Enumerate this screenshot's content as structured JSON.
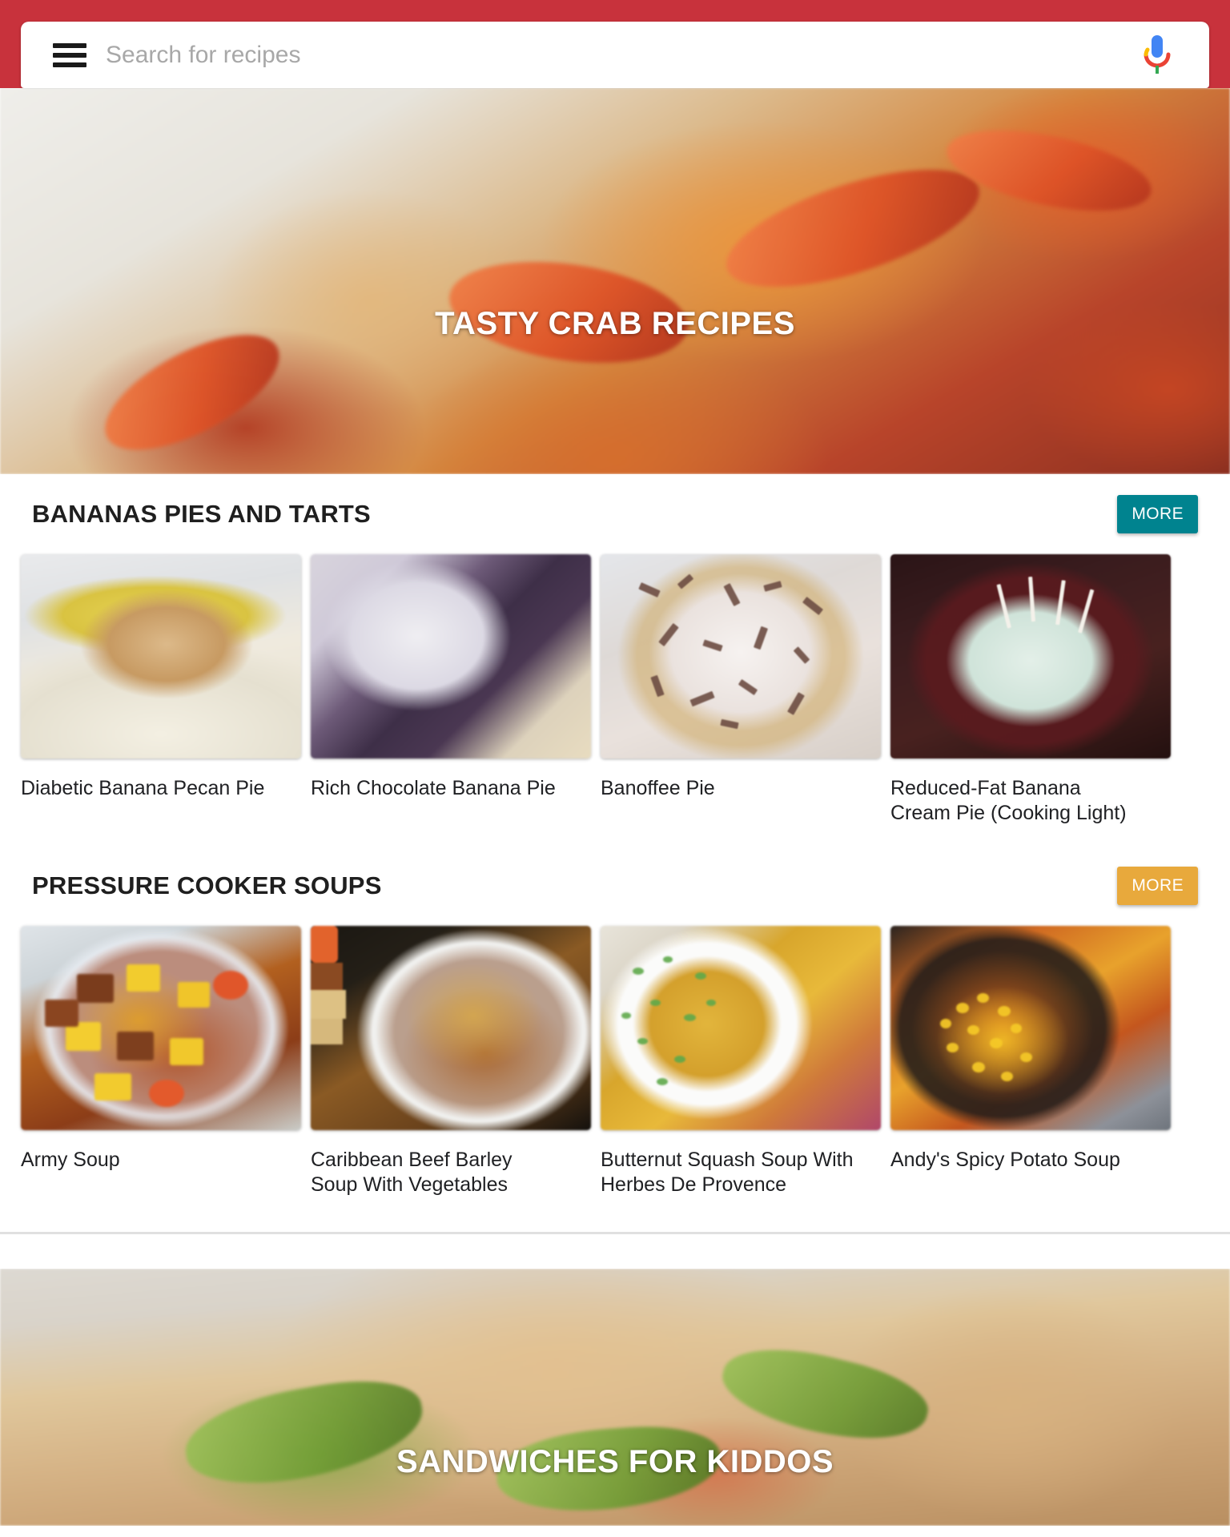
{
  "app": {
    "accent_red": "#c8323c"
  },
  "search": {
    "placeholder": "Search for recipes",
    "value": "",
    "menu_icon": "hamburger-menu-icon",
    "mic_icon": "google-microphone-icon"
  },
  "hero_top": {
    "title": "TASTY CRAB RECIPES"
  },
  "hero_bottom": {
    "title": "SANDWICHES FOR KIDDOS"
  },
  "sections": [
    {
      "title": "BANANAS PIES AND TARTS",
      "more_label": "MORE",
      "more_color": "#00838f",
      "cards": [
        {
          "label": "Diabetic Banana Pecan Pie"
        },
        {
          "label": "Rich Chocolate Banana Pie"
        },
        {
          "label": "Banoffee Pie"
        },
        {
          "label": "Reduced-Fat Banana Cream Pie (Cooking Light)"
        }
      ]
    },
    {
      "title": "PRESSURE COOKER SOUPS",
      "more_label": "MORE",
      "more_color": "#e8a93c",
      "cards": [
        {
          "label": "Army Soup"
        },
        {
          "label": "Caribbean Beef Barley Soup With Vegetables"
        },
        {
          "label": "Butternut Squash Soup With Herbes De Provence"
        },
        {
          "label": "Andy's Spicy Potato Soup"
        }
      ]
    }
  ]
}
